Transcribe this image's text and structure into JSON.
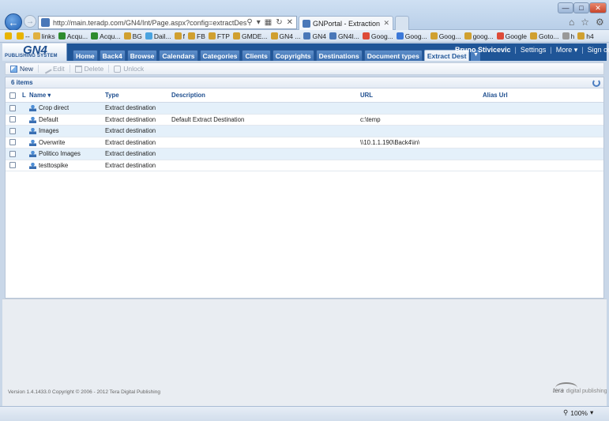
{
  "browser": {
    "address_url": "http://main.teradp.com/GN4/Int/Page.aspx?config=extractDest",
    "tab_title": "GNPortal - Extraction Desti...",
    "favorites": [
      {
        "label": "",
        "icon": "star-icon",
        "color": "#e8b400"
      },
      {
        "label": "--",
        "icon": "add-favorite-icon",
        "color": "#e8b400"
      },
      {
        "label": "links",
        "icon": "folder-icon",
        "color": "#e0b040"
      },
      {
        "label": "Acqu...",
        "icon": "g-icon",
        "color": "#2e8b2e"
      },
      {
        "label": "Acqu...",
        "icon": "g-icon",
        "color": "#2e8b2e"
      },
      {
        "label": "BG",
        "icon": "page-icon",
        "color": "#d0a030"
      },
      {
        "label": "Dail...",
        "icon": "bird-icon",
        "color": "#4aa3df"
      },
      {
        "label": "f",
        "icon": "page-icon",
        "color": "#d0a030"
      },
      {
        "label": "FB",
        "icon": "page-icon",
        "color": "#d0a030"
      },
      {
        "label": "FTP",
        "icon": "page-icon",
        "color": "#d0a030"
      },
      {
        "label": "GMDE...",
        "icon": "page-icon",
        "color": "#d0a030"
      },
      {
        "label": "GN4 ...",
        "icon": "page-icon",
        "color": "#d0a030"
      },
      {
        "label": "GN4",
        "icon": "gn-icon",
        "color": "#4a78b8"
      },
      {
        "label": "GN4I...",
        "icon": "gn-icon",
        "color": "#4a78b8"
      },
      {
        "label": "Goog...",
        "icon": "google-icon",
        "color": "#dd4b39"
      },
      {
        "label": "Goog...",
        "icon": "google-icon",
        "color": "#3b78d8"
      },
      {
        "label": "Goog...",
        "icon": "page-icon",
        "color": "#d0a030"
      },
      {
        "label": "goog...",
        "icon": "page-icon",
        "color": "#d0a030"
      },
      {
        "label": "Google",
        "icon": "google-icon",
        "color": "#dd4b39"
      },
      {
        "label": "Goto...",
        "icon": "page-icon",
        "color": "#d0a030"
      },
      {
        "label": "h",
        "icon": "page-icon",
        "color": "#999999"
      },
      {
        "label": "h4",
        "icon": "page-icon",
        "color": "#d0a030"
      }
    ],
    "zoom": "100%"
  },
  "app": {
    "logo_text": "GN4",
    "logo_sub": "PUBLISHING SYSTEM",
    "nav": [
      "Home",
      "Back4",
      "Browse",
      "Calendars",
      "Categories",
      "Clients",
      "Copyrights",
      "Destinations",
      "Document types",
      "Extract Dest"
    ],
    "active_nav": "Extract Dest",
    "user": "Bruno Stivicevic",
    "user_links": [
      "Settings",
      "More",
      "Sign out"
    ]
  },
  "toolbar": {
    "new": "New",
    "edit": "Edit",
    "delete": "Delete",
    "unlock": "Unlock"
  },
  "grid": {
    "count": "6 items",
    "columns": {
      "l": "L",
      "name": "Name",
      "type": "Type",
      "description": "Description",
      "url": "URL",
      "alias": "Alias Url"
    },
    "rows": [
      {
        "name": "Crop direct",
        "type": "Extract destination",
        "description": "",
        "url": "",
        "alias": ""
      },
      {
        "name": "Default",
        "type": "Extract destination",
        "description": "Default Extract Destination",
        "url": "c:\\temp",
        "alias": ""
      },
      {
        "name": "Images",
        "type": "Extract destination",
        "description": "",
        "url": "",
        "alias": ""
      },
      {
        "name": "Overwrite",
        "type": "Extract destination",
        "description": "",
        "url": "\\\\10.1.1.190\\Back4\\in\\",
        "alias": ""
      },
      {
        "name": "Politico Images",
        "type": "Extract destination",
        "description": "",
        "url": "",
        "alias": ""
      },
      {
        "name": "testtospike",
        "type": "Extract destination",
        "description": "",
        "url": "",
        "alias": ""
      }
    ]
  },
  "footer": {
    "version": "Version 1.4.1433.0 Copyright © 2006 - 2012 Tera Digital Publishing",
    "brand": "tera",
    "brand_sub": "digital publishing"
  }
}
